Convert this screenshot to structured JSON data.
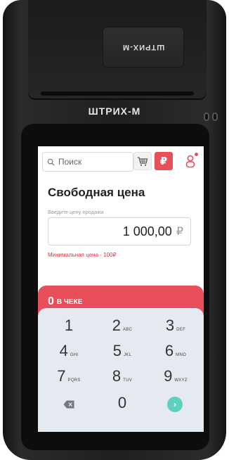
{
  "device": {
    "brand": "ШТРИХ-М",
    "cover_label": "ШТРИХ-М"
  },
  "topbar": {
    "search_placeholder": "Поиск",
    "ruble_symbol": "₽",
    "icons": {
      "search": "search-icon",
      "cart": "cart-icon",
      "ruble": "ruble-icon",
      "user": "user-icon"
    },
    "accent_color": "#e84f5b"
  },
  "main": {
    "title": "Свободная цена",
    "price_hint": "Введите цену продажи",
    "price_value": "1 000,00",
    "price_currency": "₽",
    "min_price_note": "Минимальная цена - 100₽"
  },
  "receipt": {
    "count": "0",
    "label": "В ЧЕКЕ"
  },
  "keypad": {
    "keys": [
      {
        "digit": "1",
        "letters": ""
      },
      {
        "digit": "2",
        "letters": "ABC"
      },
      {
        "digit": "3",
        "letters": "DEF"
      },
      {
        "digit": "4",
        "letters": "GHI"
      },
      {
        "digit": "5",
        "letters": "JKL"
      },
      {
        "digit": "6",
        "letters": "MNO"
      },
      {
        "digit": "7",
        "letters": "PQRS"
      },
      {
        "digit": "8",
        "letters": "TUV"
      },
      {
        "digit": "9",
        "letters": "WXYZ"
      },
      {
        "digit": "0",
        "letters": ""
      }
    ],
    "backspace_icon": "backspace-icon",
    "enter_icon": "chevron-right-icon",
    "enter_glyph": "›",
    "enter_color": "#5fcfc0"
  }
}
